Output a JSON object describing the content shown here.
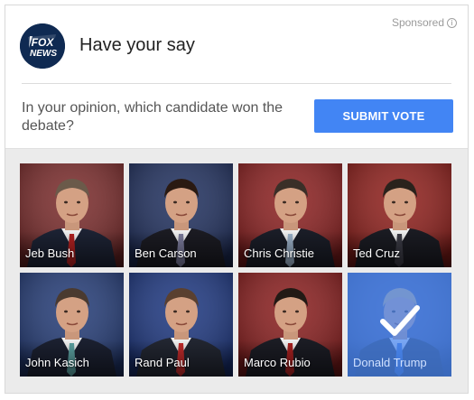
{
  "ad": {
    "sponsored_label": "Sponsored",
    "info_icon": "i",
    "logo": {
      "text_top": "FOX",
      "text_bottom": "NEWS",
      "icon": "fox-news-logo"
    },
    "title": "Have your say",
    "question": "In your opinion, which candidate won the debate?",
    "submit_label": "SUBMIT VOTE"
  },
  "colors": {
    "accent": "#4285f4",
    "selected_overlay": "#4c8bf5",
    "grid_bg": "#ebebeb"
  },
  "candidates": [
    {
      "name": "Jeb Bush",
      "backdrop": "#7a2a2a",
      "suit": "#1c2233",
      "tie": "#b02020",
      "hair": "#6b5a4a",
      "selected": false
    },
    {
      "name": "Ben Carson",
      "backdrop": "#1f2f5e",
      "suit": "#1b1b22",
      "tie": "#7a7a9a",
      "hair": "#2a1a12",
      "selected": false
    },
    {
      "name": "Chris Christie",
      "backdrop": "#8c1f1f",
      "suit": "#1a1d27",
      "tie": "#9ab0c8",
      "hair": "#3a2f28",
      "selected": false
    },
    {
      "name": "Ted Cruz",
      "backdrop": "#8f1e1a",
      "suit": "#1a1b22",
      "tie": "#3a3a44",
      "hair": "#2a221c",
      "selected": false
    },
    {
      "name": "John Kasich",
      "backdrop": "#233b77",
      "suit": "#1b2030",
      "tie": "#5aa0a0",
      "hair": "#4a3a30",
      "selected": false
    },
    {
      "name": "Rand Paul",
      "backdrop": "#1c3680",
      "suit": "#222631",
      "tie": "#c02a2a",
      "hair": "#5a4030",
      "selected": false
    },
    {
      "name": "Marco Rubio",
      "backdrop": "#8a1d1d",
      "suit": "#1b1c24",
      "tie": "#a82020",
      "hair": "#221a15",
      "selected": false
    },
    {
      "name": "Donald Trump",
      "backdrop": "#2a3b7a",
      "suit": "#1d2230",
      "tie": "#3a6fd0",
      "hair": "#d8b070",
      "selected": true
    }
  ]
}
